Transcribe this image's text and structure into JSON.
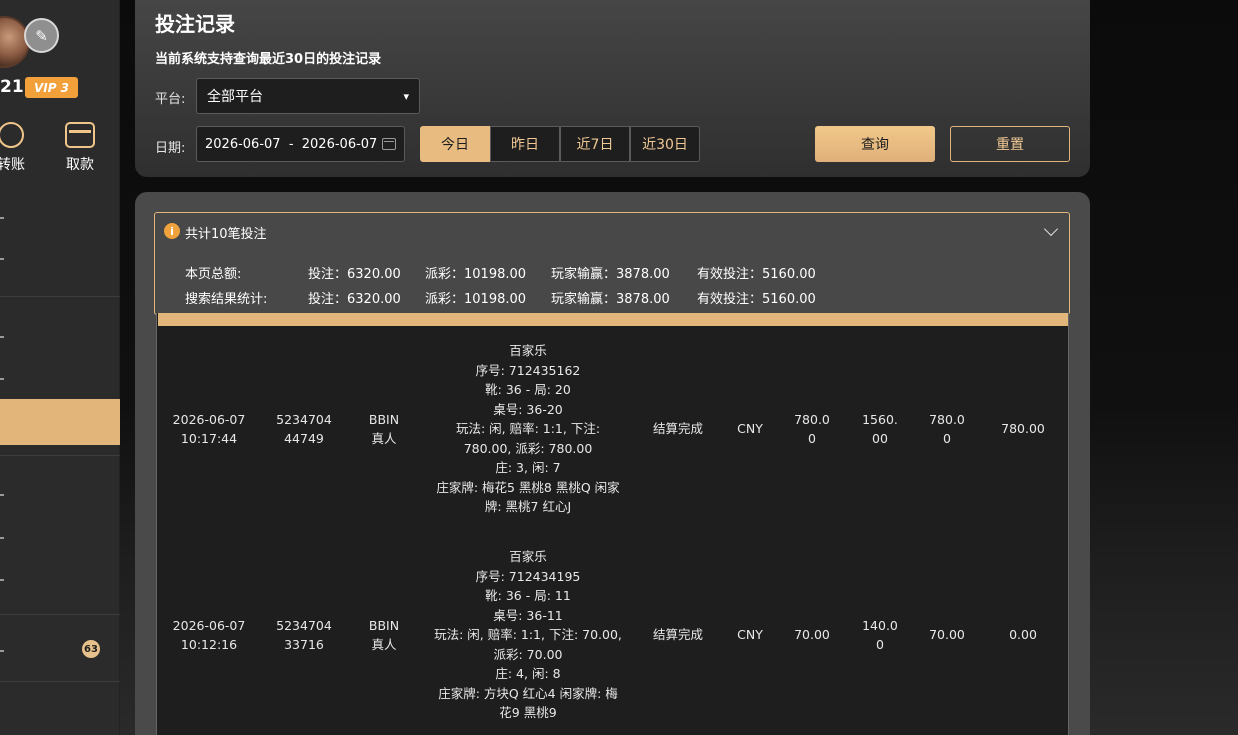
{
  "sidebar": {
    "username_tail": "21",
    "vip_label": "VIP 3",
    "actions": [
      {
        "label": "转账",
        "icon": "transfer-icon"
      },
      {
        "label": "取款",
        "icon": "card-icon"
      }
    ],
    "badge_count": "63"
  },
  "header": {
    "title": "投注记录",
    "subtitle": "当前系统支持查询最近30日的投注记录"
  },
  "filters": {
    "platform_label": "平台:",
    "platform_value": "全部平台",
    "date_label": "日期:",
    "date_range": "2026-06-07  -  2026-06-07",
    "quick_ranges": [
      "今日",
      "昨日",
      "近7日",
      "近30日"
    ],
    "active_range": "今日",
    "query_label": "查询",
    "reset_label": "重置"
  },
  "summary": {
    "title": "共计10笔投注",
    "rows": [
      {
        "label": "本页总额:",
        "bet": "投注：6320.00",
        "payout": "派彩：10198.00",
        "win": "玩家输赢：3878.00",
        "valid": "有效投注：5160.00"
      },
      {
        "label": "搜索结果统计:",
        "bet": "投注：6320.00",
        "payout": "派彩：10198.00",
        "win": "玩家输赢：3878.00",
        "valid": "有效投注：5160.00"
      }
    ]
  },
  "records": [
    {
      "date": "2026-06-07",
      "time": "10:17:44",
      "order_a": "5234704",
      "order_b": "44749",
      "platform_a": "BBIN",
      "platform_b": "真人",
      "details": [
        "百家乐",
        "序号: 712435162",
        "靴: 36 - 局: 20",
        "桌号: 36-20",
        "玩法: 闲, 赔率: 1:1, 下注:",
        "780.00, 派彩: 780.00",
        "庄: 3, 闲: 7",
        "庄家牌: 梅花5 黑桃8 黑桃Q 闲家",
        "牌: 黑桃7 红心J"
      ],
      "status": "结算完成",
      "currency": "CNY",
      "bet_a": "780.0",
      "bet_b": "0",
      "payout_a": "1560.",
      "payout_b": "00",
      "valid_a": "780.0",
      "valid_b": "0",
      "winloss": "780.00"
    },
    {
      "date": "2026-06-07",
      "time": "10:12:16",
      "order_a": "5234704",
      "order_b": "33716",
      "platform_a": "BBIN",
      "platform_b": "真人",
      "details": [
        "百家乐",
        "序号: 712434195",
        "靴: 36 - 局: 11",
        "桌号: 36-11",
        "玩法: 闲, 赔率: 1:1, 下注: 70.00,",
        "派彩: 70.00",
        "庄: 4, 闲: 8",
        "庄家牌: 方块Q 红心4 闲家牌: 梅",
        "花9 黑桃9"
      ],
      "status": "结算完成",
      "currency": "CNY",
      "bet_a": "70.00",
      "bet_b": "",
      "payout_a": "140.0",
      "payout_b": "0",
      "valid_a": "70.00",
      "valid_b": "",
      "winloss": "0.00"
    }
  ]
}
